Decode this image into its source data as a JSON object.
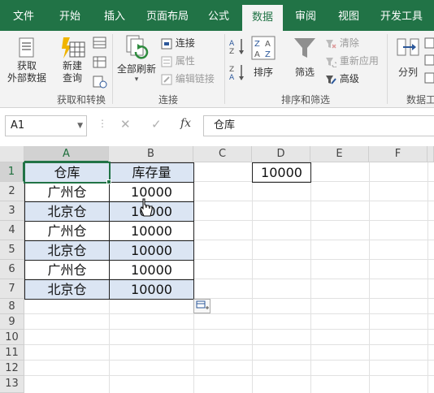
{
  "tabs": [
    "文件",
    "开始",
    "插入",
    "页面布局",
    "公式",
    "数据",
    "审阅",
    "视图",
    "开发工具"
  ],
  "active_tab": "数据",
  "ribbon": {
    "get_external_data": "获取\n外部数据",
    "new_query": "新建\n查询",
    "group_get_transform": "获取和转换",
    "refresh_all": "全部刷新",
    "connections": "连接",
    "properties": "属性",
    "edit_links": "编辑链接",
    "group_connections": "连接",
    "sort": "排序",
    "filter": "筛选",
    "clear": "清除",
    "reapply": "重新应用",
    "advanced": "高级",
    "group_sort_filter": "排序和筛选",
    "text_to_columns": "分列",
    "group_data_tools": "数据工"
  },
  "formula_bar": {
    "name_box": "A1",
    "fx": "fx",
    "content": "仓库"
  },
  "columns": [
    "A",
    "B",
    "C",
    "D",
    "E",
    "F"
  ],
  "rows": [
    "1",
    "2",
    "3",
    "4",
    "5",
    "6",
    "7",
    "8",
    "9",
    "10",
    "11",
    "12",
    "13"
  ],
  "cells": {
    "A1": "仓库",
    "B1": "库存量",
    "A2": "广州仓",
    "B2": "10000",
    "A3": "北京仓",
    "B3": "10000",
    "A4": "广州仓",
    "B4": "10000",
    "A5": "北京仓",
    "B5": "10000",
    "A6": "广州仓",
    "B6": "10000",
    "A7": "北京仓",
    "B7": "10000",
    "D1": "10000"
  },
  "colors": {
    "accent": "#217346",
    "banded_fill": "#dbe5f3"
  }
}
